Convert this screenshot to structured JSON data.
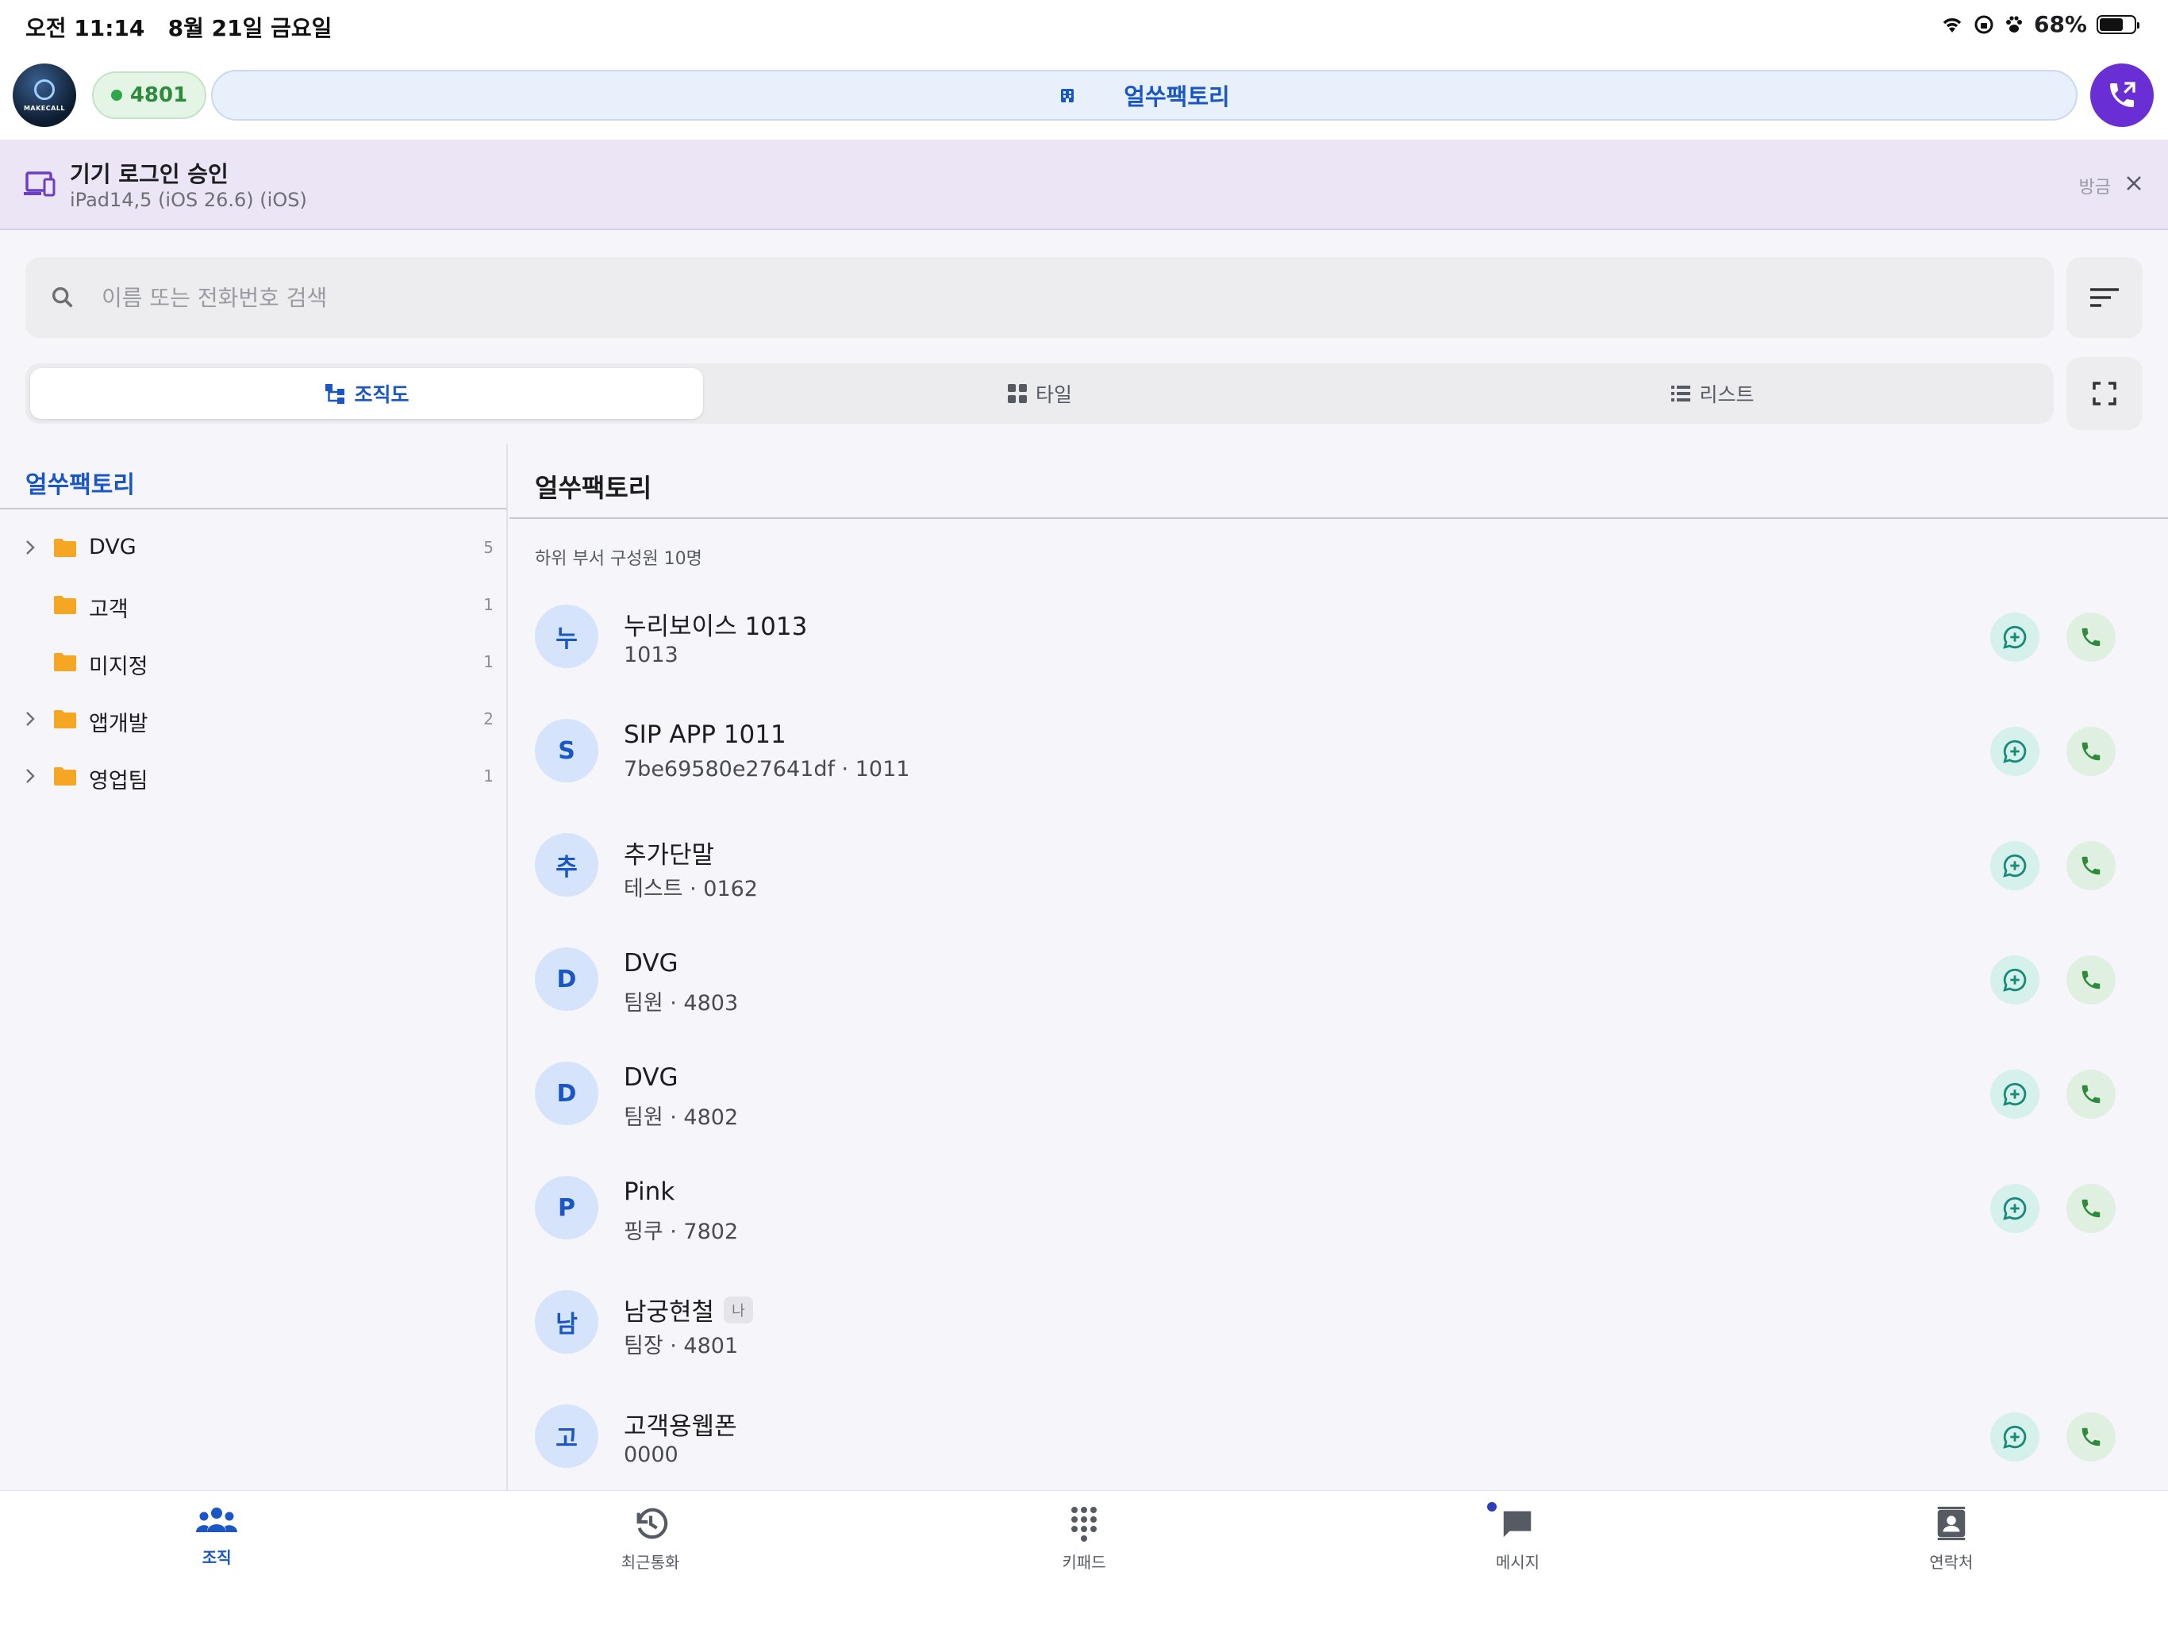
{
  "status_bar": {
    "time": "오전 11:14",
    "date": "8월 21일 금요일",
    "battery": "68%",
    "battery_level": 0.68
  },
  "header": {
    "avatar_brand": "MAKECALL",
    "extension": "4801",
    "company": "얼쑤팩토리",
    "colors": {
      "accent": "#1a56c4",
      "fab": "#6a2fd4",
      "online": "#2ea84a"
    }
  },
  "banner": {
    "title": "기기 로그인 승인",
    "subtitle": "iPad14,5 (iOS 26.6) (iOS)",
    "time": "방금"
  },
  "search": {
    "placeholder": "이름 또는 전화번호 검색",
    "value": ""
  },
  "view_tabs": [
    {
      "label": "조직도",
      "icon": "org-chart-icon",
      "active": true
    },
    {
      "label": "타일",
      "icon": "grid-icon",
      "active": false
    },
    {
      "label": "리스트",
      "icon": "list-icon",
      "active": false
    }
  ],
  "tree": {
    "root": "얼쑤팩토리",
    "items": [
      {
        "name": "DVG",
        "count": "5",
        "expandable": true
      },
      {
        "name": "고객",
        "count": "1",
        "expandable": false
      },
      {
        "name": "미지정",
        "count": "1",
        "expandable": false
      },
      {
        "name": "앱개발",
        "count": "2",
        "expandable": true
      },
      {
        "name": "영업팀",
        "count": "1",
        "expandable": true
      }
    ]
  },
  "panel": {
    "title": "얼쑤팩토리",
    "subtitle": "하위 부서 구성원 10명",
    "members": [
      {
        "initial": "누",
        "name": "누리보이스 1013",
        "sub": "1013",
        "me": "",
        "actions": true
      },
      {
        "initial": "S",
        "name": "SIP APP 1011",
        "sub": "7be69580e27641df · 1011",
        "me": "",
        "actions": true
      },
      {
        "initial": "추",
        "name": "추가단말",
        "sub": "테스트 · 0162",
        "me": "",
        "actions": true
      },
      {
        "initial": "D",
        "name": "DVG",
        "sub": "팀원 · 4803",
        "me": "",
        "actions": true
      },
      {
        "initial": "D",
        "name": "DVG",
        "sub": "팀원 · 4802",
        "me": "",
        "actions": true
      },
      {
        "initial": "P",
        "name": "Pink",
        "sub": "핑쿠 · 7802",
        "me": "",
        "actions": true
      },
      {
        "initial": "남",
        "name": "남궁현철",
        "sub": "팀장 · 4801",
        "me": "나",
        "actions": false
      },
      {
        "initial": "고",
        "name": "고객용웹폰",
        "sub": "0000",
        "me": "",
        "actions": true
      }
    ]
  },
  "bottom_nav": [
    {
      "label": "조직",
      "icon": "people-icon",
      "active": true
    },
    {
      "label": "최근통화",
      "icon": "history-icon",
      "active": false
    },
    {
      "label": "키패드",
      "icon": "keypad-icon",
      "active": false
    },
    {
      "label": "메시지",
      "icon": "message-icon",
      "active": false,
      "badge": true
    },
    {
      "label": "연락처",
      "icon": "contacts-icon",
      "active": false
    }
  ]
}
